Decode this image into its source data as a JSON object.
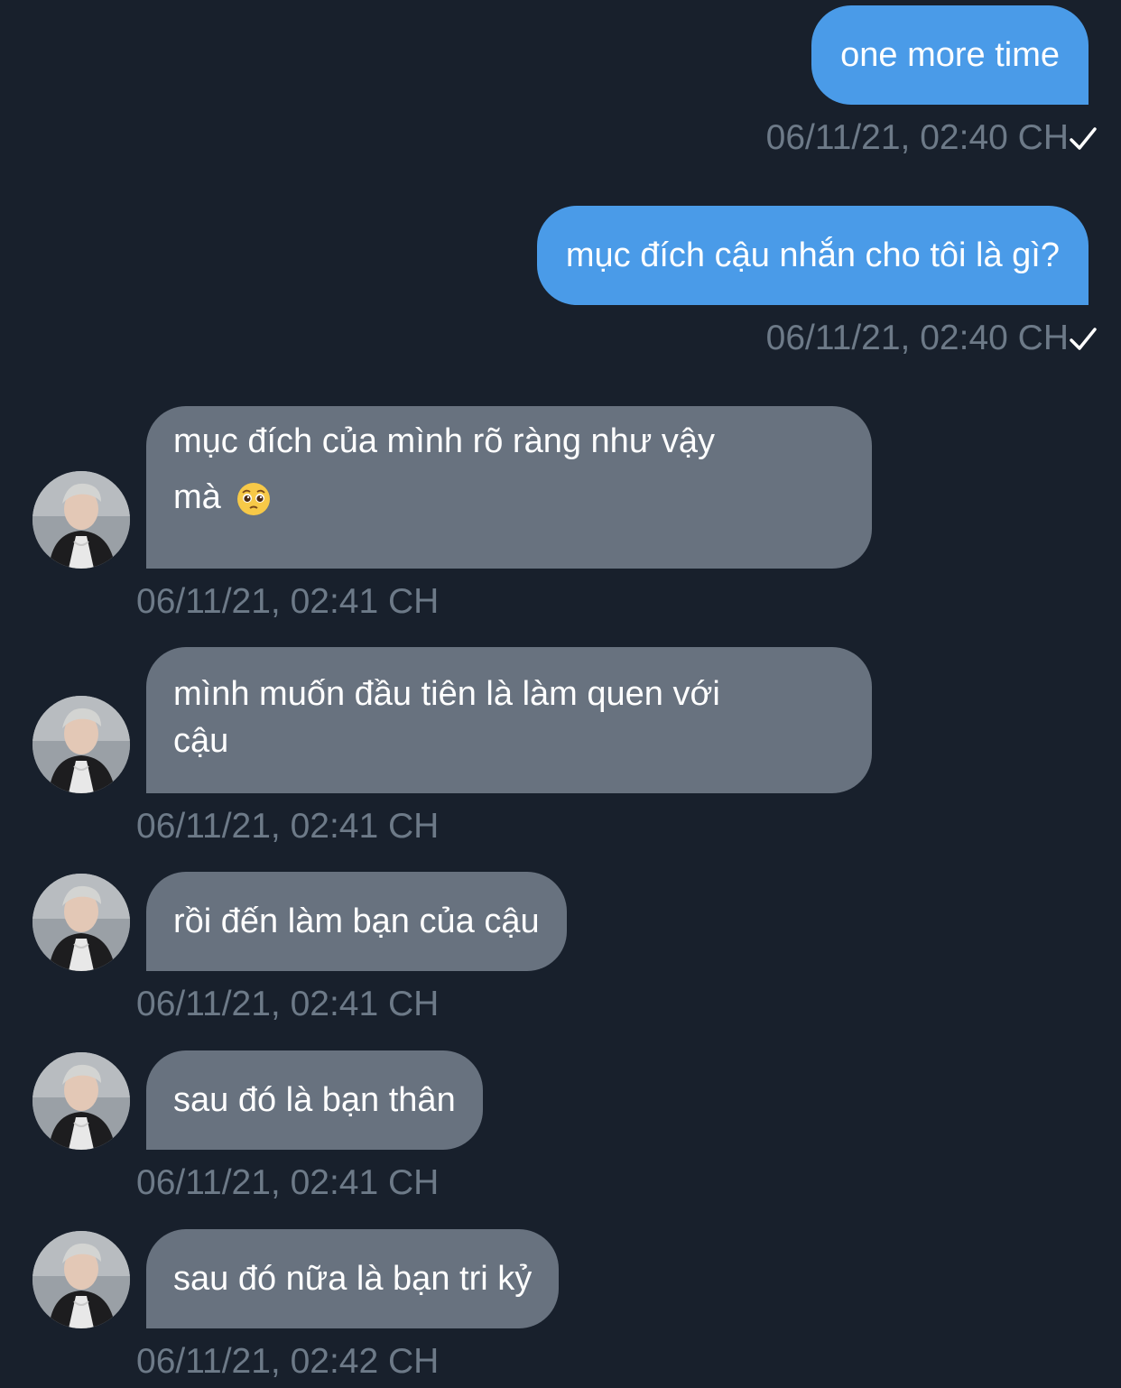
{
  "messages": [
    {
      "direction": "sent",
      "text": "one more time",
      "time": "06/11/21, 02:40 CH",
      "status": "sent-check"
    },
    {
      "direction": "sent",
      "text": "mục đích cậu nhắn cho tôi là gì?",
      "time": "06/11/21, 02:40 CH",
      "status": "sent-check"
    },
    {
      "direction": "received",
      "line1": "mục đích của mình rõ ràng như vậy",
      "line2": "mà",
      "emoji": "pleading-face",
      "time": "06/11/21, 02:41 CH"
    },
    {
      "direction": "received",
      "line1": "mình muốn đầu tiên là làm quen với",
      "line2": "cậu",
      "time": "06/11/21, 02:41 CH"
    },
    {
      "direction": "received",
      "text": "rồi đến làm bạn của cậu",
      "time": "06/11/21, 02:41 CH"
    },
    {
      "direction": "received",
      "text": "sau đó là bạn thân",
      "time": "06/11/21, 02:41 CH"
    },
    {
      "direction": "received",
      "text": "sau đó nữa là bạn tri kỷ",
      "time": "06/11/21, 02:42 CH"
    }
  ],
  "colors": {
    "background": "#18202c",
    "sent_bubble": "#4a9be8",
    "received_bubble": "#68727f",
    "timestamp": "#6d7a88",
    "text": "#ffffff"
  },
  "icons": {
    "read_status": "check-icon",
    "avatar": "avatar-photo",
    "emoji": "pleading-face-emoji"
  }
}
